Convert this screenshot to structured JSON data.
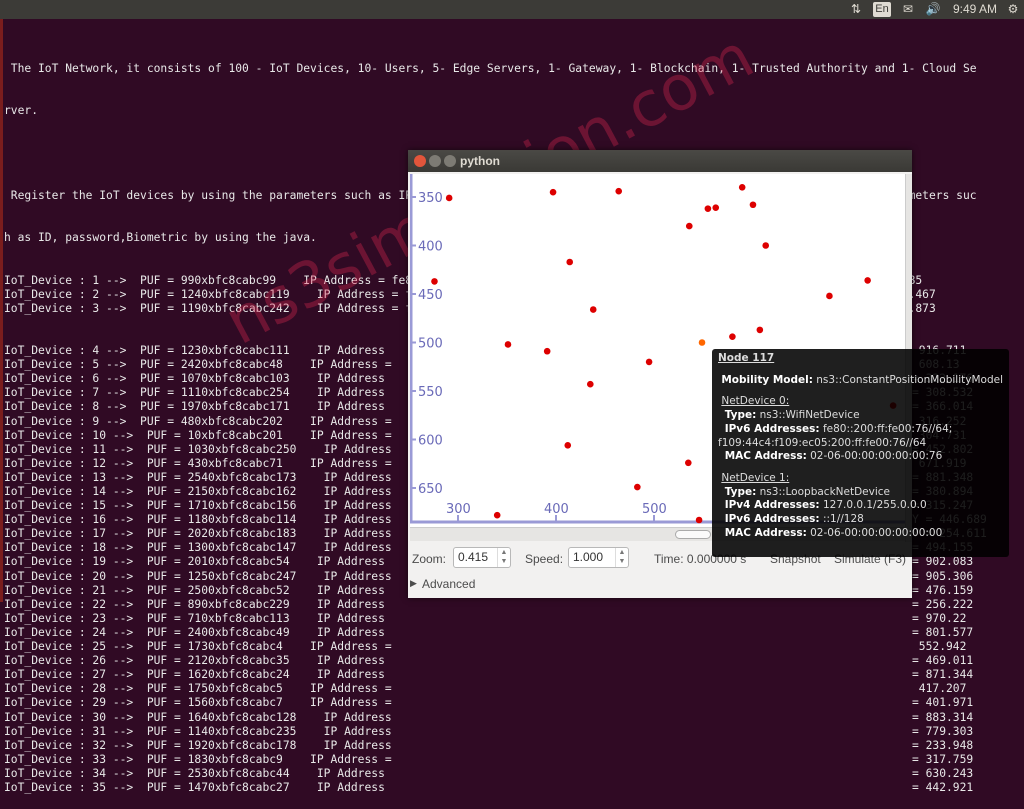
{
  "panel": {
    "clock": "9:49 AM",
    "keyboard": "En"
  },
  "terminal": {
    "intro1": " The IoT Network, it consists of 100 - IoT Devices, 10- Users, 5- Edge Servers, 1- Gateway, 1- Blockchain, 1- Trusted Authority and 1- Cloud Se",
    "intro1b": "rver.",
    "intro2": " Register the IoT devices by using the parameters such as IP address and PUF and MAC address and register IoT users by using the parameters suc",
    "intro2b": "h as ID, password,Biometric by using the java.",
    "full_rows": [
      "IoT_Device : 1 -->  PUF = 990xbfc8cabc99    IP Address = fe80::200:ff:fe00:1    Mac Address = 00:00:00:00:00:01 X = 956.488 Y = 762.085",
      "IoT_Device : 2 -->  PUF = 1240xbfc8cabc119    IP Address = fe80::200:ff:fe00:2    Mac Address = 00:00:00:00:00:02 X = 909.508 Y = 758.467",
      "IoT_Device : 3 -->  PUF = 1190xbfc8cabc242    IP Address = fe80::200:ff:fe00:3    Mac Address = 00:00:00:00:00:03 X = 549.386 Y = 696.873"
    ],
    "rows": [
      {
        "left": "IoT_Device : 4 -->  PUF = 1230xbfc8cabc111    IP Address",
        "tail": " 916.711"
      },
      {
        "left": "IoT_Device : 5 -->  PUF = 2420xbfc8cabc48    IP Address =",
        "tail": " 608.13"
      },
      {
        "left": "IoT_Device : 6 -->  PUF = 1070xbfc8cabc103    IP Address",
        "tail": "= 322.176"
      },
      {
        "left": "IoT_Device : 7 -->  PUF = 1110xbfc8cabc254    IP Address",
        "tail": "= 308.532"
      },
      {
        "left": "IoT_Device : 8 -->  PUF = 1970xbfc8cabc171    IP Address",
        "tail": "= 366.014"
      },
      {
        "left": "IoT_Device : 9 -->  PUF = 480xbfc8cabc202    IP Address =",
        "tail": " 316.252"
      },
      {
        "left": "IoT_Device : 10 -->  PUF = 10xbfc8cabc201    IP Address =",
        "tail": " 304.731"
      },
      {
        "left": "IoT_Device : 11 -->  PUF = 1030xbfc8cabc250    IP Address",
        "tail": "= 452.802"
      },
      {
        "left": "IoT_Device : 12 -->  PUF = 430xbfc8cabc71    IP Address =",
        "tail": " 671.919"
      },
      {
        "left": "IoT_Device : 13 -->  PUF = 2540xbfc8cabc173    IP Address",
        "tail": "= 881.348"
      },
      {
        "left": "IoT_Device : 14 -->  PUF = 2150xbfc8cabc162    IP Address",
        "tail": "= 380.894"
      },
      {
        "left": "IoT_Device : 15 -->  PUF = 1710xbfc8cabc156    IP Address",
        "tail": "= 315.247"
      },
      {
        "left": "IoT_Device : 16 -->  PUF = 1180xbfc8cabc114    IP Address",
        "tail": "Y = 446.689"
      },
      {
        "left": "IoT_Device : 17 -->  PUF = 2020xbfc8cabc183    IP Address",
        "tail": "Y = 254.611"
      },
      {
        "left": "IoT_Device : 18 -->  PUF = 1300xbfc8cabc147    IP Address",
        "tail": "= 494.155"
      },
      {
        "left": "IoT_Device : 19 -->  PUF = 2010xbfc8cabc54    IP Address",
        "tail": "= 902.083"
      },
      {
        "left": "IoT_Device : 20 -->  PUF = 1250xbfc8cabc247    IP Address",
        "tail": "= 905.306"
      },
      {
        "left": "IoT_Device : 21 -->  PUF = 2500xbfc8cabc52    IP Address",
        "tail": "= 476.159"
      },
      {
        "left": "IoT_Device : 22 -->  PUF = 890xbfc8cabc229    IP Address",
        "tail": "= 256.222"
      },
      {
        "left": "IoT_Device : 23 -->  PUF = 710xbfc8cabc113    IP Address",
        "tail": "= 970.22"
      },
      {
        "left": "IoT_Device : 24 -->  PUF = 2400xbfc8cabc49    IP Address",
        "tail": "= 801.577"
      },
      {
        "left": "IoT_Device : 25 -->  PUF = 1730xbfc8cabc4    IP Address =",
        "tail": " 552.942"
      },
      {
        "left": "IoT_Device : 26 -->  PUF = 2120xbfc8cabc35    IP Address",
        "tail": "= 469.011"
      },
      {
        "left": "IoT_Device : 27 -->  PUF = 1620xbfc8cabc24    IP Address",
        "tail": "= 871.344"
      },
      {
        "left": "IoT_Device : 28 -->  PUF = 1750xbfc8cabc5    IP Address =",
        "tail": " 417.207"
      },
      {
        "left": "IoT_Device : 29 -->  PUF = 1560xbfc8cabc7    IP Address =",
        "tail": "= 401.971"
      },
      {
        "left": "IoT_Device : 30 -->  PUF = 1640xbfc8cabc128    IP Address",
        "tail": "= 883.314"
      },
      {
        "left": "IoT_Device : 31 -->  PUF = 1140xbfc8cabc235    IP Address",
        "tail": "= 779.303"
      },
      {
        "left": "IoT_Device : 32 -->  PUF = 1920xbfc8cabc178    IP Address",
        "tail": "= 233.948"
      },
      {
        "left": "IoT_Device : 33 -->  PUF = 1830xbfc8cabc9    IP Address =",
        "tail": "= 317.759"
      },
      {
        "left": "IoT_Device : 34 -->  PUF = 2530xbfc8cabc44    IP Address",
        "tail": "= 630.243"
      },
      {
        "left": "IoT_Device : 35 -->  PUF = 1470xbfc8cabc27    IP Address",
        "tail": "= 442.921"
      }
    ]
  },
  "python_window": {
    "title": "python",
    "canvas": {
      "y_ticks": [
        350,
        400,
        450,
        500,
        550,
        600,
        650
      ],
      "x_ticks": [
        300,
        400,
        500
      ],
      "node_color": "#dd0000",
      "selected_node_color": "#ff6600",
      "nodes": [
        [
          291,
          351
        ],
        [
          397,
          345
        ],
        [
          464,
          344
        ],
        [
          590,
          340
        ],
        [
          555,
          362
        ],
        [
          563,
          361
        ],
        [
          601,
          358
        ],
        [
          536,
          380
        ],
        [
          614,
          400
        ],
        [
          276,
          437
        ],
        [
          414,
          417
        ],
        [
          718,
          436
        ],
        [
          679,
          452
        ],
        [
          438,
          466
        ],
        [
          351,
          502
        ],
        [
          391,
          509
        ],
        [
          549,
          500,
          "selected"
        ],
        [
          580,
          494
        ],
        [
          608,
          487
        ],
        [
          495,
          520
        ],
        [
          435,
          543
        ],
        [
          744,
          565
        ],
        [
          412,
          606
        ],
        [
          535,
          624
        ],
        [
          483,
          649
        ],
        [
          340,
          678
        ],
        [
          546,
          683
        ]
      ]
    },
    "controls": {
      "zoom_label": "Zoom:",
      "zoom_value": "0.415",
      "speed_label": "Speed:",
      "speed_value": "1.000",
      "time_label": "Time: 0.000000 s",
      "snapshot": "Snapshot",
      "simulate": "Simulate (F3)",
      "advanced": "Advanced"
    }
  },
  "tooltip": {
    "title": "Node 117",
    "mobility_label": "Mobility Model:",
    "mobility_value": " ns3::ConstantPositionMobilityModel",
    "dev0_title": "NetDevice 0:",
    "dev0_type_label": "Type:",
    "dev0_type": " ns3::WifiNetDevice",
    "dev0_ipv6_label": "IPv6 Addresses:",
    "dev0_ipv6": " fe80::200:ff:fe00:76//64;",
    "dev0_ipv6b": "f109:44c4:f109:ec05:200:ff:fe00:76//64",
    "dev0_mac_label": "MAC Address:",
    "dev0_mac": " 02-06-00:00:00:00:00:76",
    "dev1_title": "NetDevice 1:",
    "dev1_type_label": "Type:",
    "dev1_type": " ns3::LoopbackNetDevice",
    "dev1_ipv4_label": "IPv4 Addresses:",
    "dev1_ipv4": " 127.0.0.1/255.0.0.0",
    "dev1_ipv6_label": "IPv6 Addresses:",
    "dev1_ipv6": " ::1//128",
    "dev1_mac_label": "MAC Address:",
    "dev1_mac": " 02-06-00:00:00:00:00:00"
  },
  "watermark": "ns3simulation.com"
}
